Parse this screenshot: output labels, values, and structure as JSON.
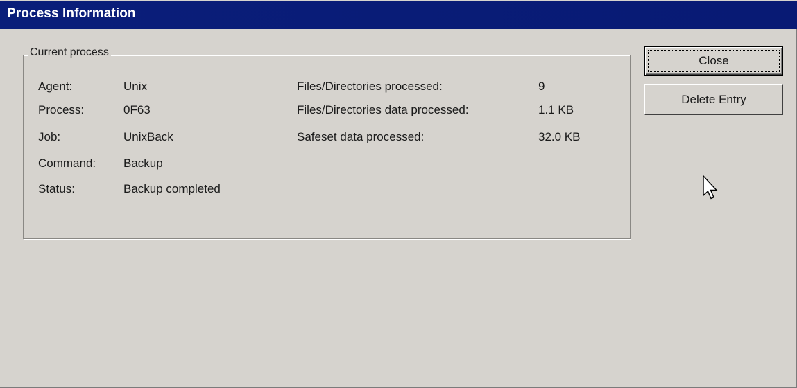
{
  "window": {
    "title": "Process Information"
  },
  "group": {
    "legend": "Current process",
    "left_fields": [
      {
        "label": "Agent:",
        "value": "Unix"
      },
      {
        "label": "Process:",
        "value": "0F63"
      },
      {
        "label": "Job:",
        "value": "UnixBack"
      },
      {
        "label": "Command:",
        "value": "Backup"
      },
      {
        "label": "Status:",
        "value": "Backup completed"
      }
    ],
    "right_fields": [
      {
        "label": "Files/Directories processed:",
        "value": "9"
      },
      {
        "label": "Files/Directories data processed:",
        "value": "1.1 KB"
      },
      {
        "label": "Safeset data processed:",
        "value": "32.0 KB"
      }
    ]
  },
  "buttons": {
    "close_label": "Close",
    "delete_label": "Delete Entry"
  },
  "icons": {
    "cursor": "mouse-pointer-icon"
  },
  "colors": {
    "titlebar": "#0a1e7a",
    "background": "#d6d3ce"
  }
}
